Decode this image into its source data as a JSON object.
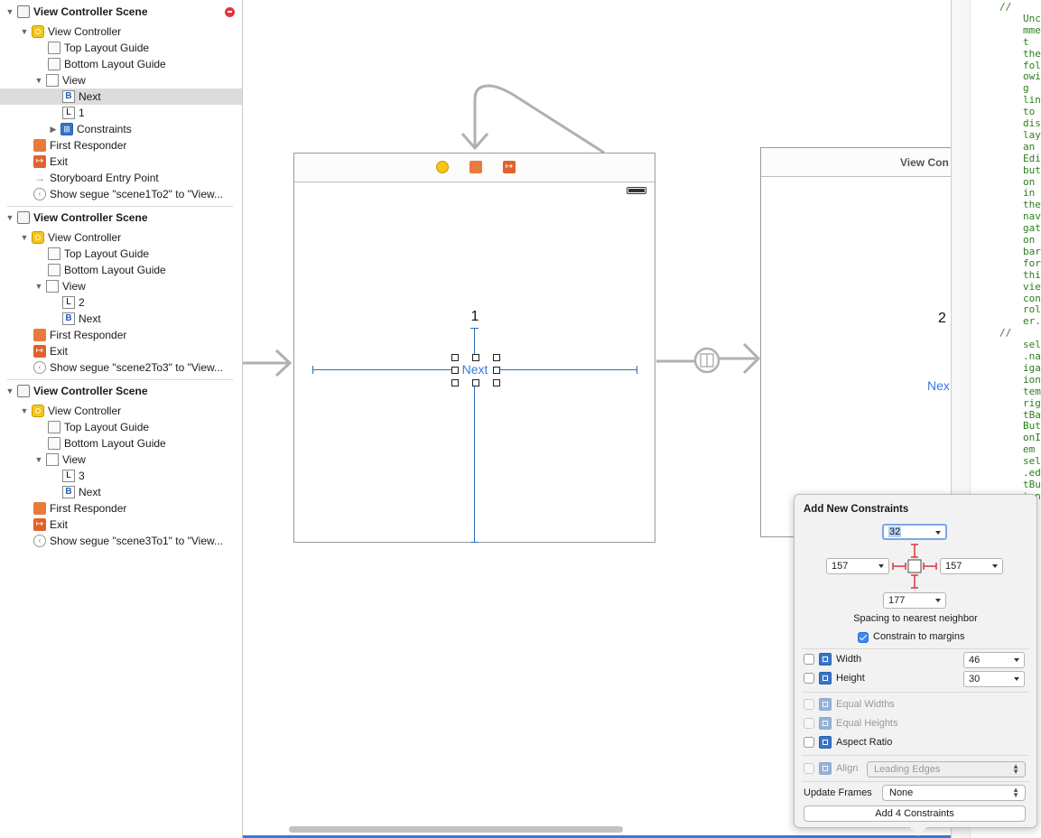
{
  "outline": {
    "scenes": [
      {
        "title": "View Controller Scene",
        "items": [
          {
            "label": "View Controller"
          },
          {
            "label": "Top Layout Guide"
          },
          {
            "label": "Bottom Layout Guide"
          },
          {
            "label": "View"
          },
          {
            "label": "Next",
            "badge": "B"
          },
          {
            "label": "1",
            "badge": "L"
          },
          {
            "label": "Constraints"
          },
          {
            "label": "First Responder"
          },
          {
            "label": "Exit"
          },
          {
            "label": "Storyboard Entry Point"
          },
          {
            "label": "Show segue \"scene1To2\" to \"View..."
          }
        ]
      },
      {
        "title": "View Controller Scene",
        "items": [
          {
            "label": "View Controller"
          },
          {
            "label": "Top Layout Guide"
          },
          {
            "label": "Bottom Layout Guide"
          },
          {
            "label": "View"
          },
          {
            "label": "2",
            "badge": "L"
          },
          {
            "label": "Next",
            "badge": "B"
          },
          {
            "label": "First Responder"
          },
          {
            "label": "Exit"
          },
          {
            "label": "Show segue \"scene2To3\" to \"View..."
          }
        ]
      },
      {
        "title": "View Controller Scene",
        "items": [
          {
            "label": "View Controller"
          },
          {
            "label": "Top Layout Guide"
          },
          {
            "label": "Bottom Layout Guide"
          },
          {
            "label": "View"
          },
          {
            "label": "3",
            "badge": "L"
          },
          {
            "label": "Next",
            "badge": "B"
          },
          {
            "label": "First Responder"
          },
          {
            "label": "Exit"
          },
          {
            "label": "Show segue \"scene3To1\" to \"View..."
          }
        ]
      }
    ]
  },
  "canvas": {
    "scene1": {
      "label_text": "1",
      "button_text": "Next"
    },
    "scene2": {
      "title": "View Con",
      "label_text": "2",
      "button_text": "Nex"
    }
  },
  "code": {
    "lines": [
      "//",
      "Unco",
      "mmen",
      "t",
      "the",
      "foll",
      "owin",
      "g",
      "line",
      "to",
      "disp",
      "lay",
      "an",
      "Edit",
      "butt",
      "on",
      "in",
      "the",
      "navi",
      "gati",
      "on",
      "bar",
      "for",
      "this",
      "view",
      "cont",
      "roll",
      "er.",
      "//",
      "self",
      ".nav",
      "igat",
      "ionI",
      "tem.",
      "righ",
      "tBar",
      "Butt",
      "onIt",
      "em =",
      "self",
      ".edi",
      "tBut",
      "ton"
    ]
  },
  "constraints_popover": {
    "title": "Add New Constraints",
    "top_value": "32",
    "leading_value": "157",
    "trailing_value": "157",
    "bottom_value": "177",
    "spacing_label": "Spacing to nearest neighbor",
    "constrain_to_margins": {
      "label": "Constrain to margins",
      "checked": true
    },
    "width": {
      "label": "Width",
      "value": "46",
      "checked": false
    },
    "height": {
      "label": "Height",
      "value": "30",
      "checked": false
    },
    "equal_widths": {
      "label": "Equal Widths"
    },
    "equal_heights": {
      "label": "Equal Heights"
    },
    "aspect_ratio": {
      "label": "Aspect Ratio"
    },
    "align": {
      "label": "Align",
      "value": "Leading Edges"
    },
    "update_frames": {
      "label": "Update Frames",
      "value": "None"
    },
    "action_label": "Add 4 Constraints"
  },
  "colors": {
    "accent": "#3b86f2",
    "selection_row": "#dcdcdc",
    "constraint_line": "#2a6fb7",
    "constraint_red": "#e0353f",
    "button_text": "#3a78e0",
    "code_comment": "#2e7d1e"
  }
}
